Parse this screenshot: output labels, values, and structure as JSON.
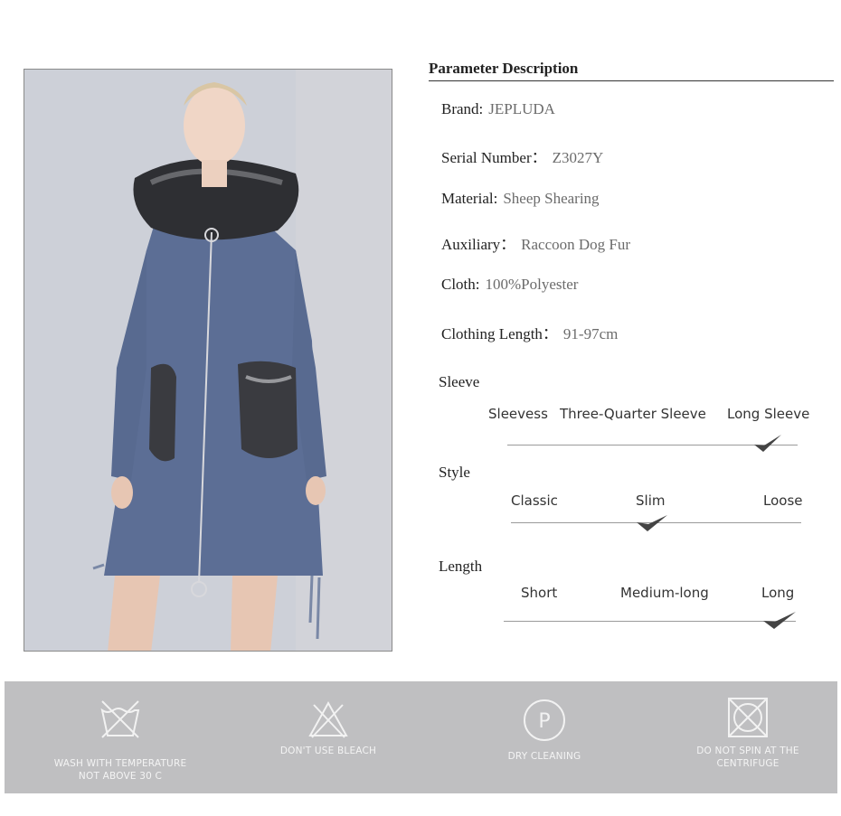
{
  "section_title": "Parameter Description",
  "params": [
    {
      "label": "Brand:",
      "value": "JEPLUDA"
    },
    {
      "label": "Serial Number：",
      "value": "Z3027Y"
    },
    {
      "label": "Material:",
      "value": "Sheep Shearing"
    },
    {
      "label": "Auxiliary：",
      "value": "Raccoon Dog Fur"
    },
    {
      "label": "Cloth:",
      "value": "100%Polyester"
    },
    {
      "label": "Clothing Length：",
      "value": "91-97cm"
    }
  ],
  "scales": [
    {
      "title": "Sleeve",
      "options": [
        "Sleevess",
        "Three-Quarter Sleeve",
        "Long Sleeve"
      ],
      "selected": "Long Sleeve"
    },
    {
      "title": "Style",
      "options": [
        "Classic",
        "Slim",
        "Loose"
      ],
      "selected": "Slim"
    },
    {
      "title": "Length",
      "options": [
        "Short",
        "Medium-long",
        "Long"
      ],
      "selected": "Long"
    }
  ],
  "care": [
    {
      "icon": "wash-tub-crossed-icon",
      "text": "WASH WITH TEMPERATURE\nNOT ABOVE 30 C"
    },
    {
      "icon": "bleach-triangle-crossed-icon",
      "text": "DON'T USE BLEACH"
    },
    {
      "icon": "dry-clean-p-circle-icon",
      "text": "DRY CLEANING"
    },
    {
      "icon": "tumble-dry-crossed-icon",
      "text": "DO NOT SPIN AT THE\nCENTRIFUGE"
    }
  ],
  "colors": {
    "coat": "#5a6c93",
    "care_band": "#bfbfc1",
    "check": "#444444"
  }
}
